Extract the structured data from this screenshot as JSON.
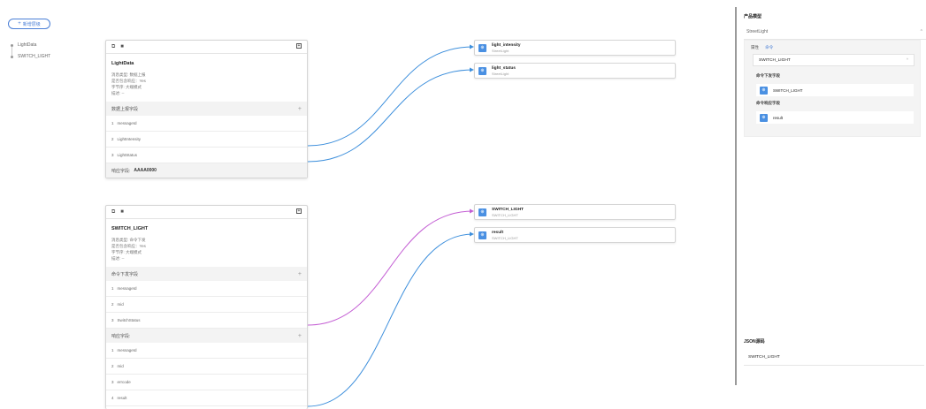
{
  "toolbar": {
    "add_label": "新增层级"
  },
  "tree": {
    "items": [
      "LightData",
      "SWITCH_LIGHT"
    ]
  },
  "cards": [
    {
      "title": "LightData",
      "meta": [
        "消息类型: 数据上报",
        "是否包含响应：Yes",
        "字节序: 大端模式",
        "描述: --"
      ],
      "sections": [
        {
          "label": "数据上报字段",
          "rows": [
            [
              "1",
              "messageId"
            ],
            [
              "2",
              "LightIntensity"
            ],
            [
              "3",
              "LightStatus"
            ]
          ]
        }
      ],
      "footer": {
        "label": "响应字段:",
        "value": "AAAA0000"
      }
    },
    {
      "title": "SWITCH_LIGHT",
      "meta": [
        "消息类型: 命令下发",
        "是否包含响应：Yes",
        "字节序: 大端模式",
        "描述: --"
      ],
      "sections": [
        {
          "label": "命令下发字段",
          "rows": [
            [
              "1",
              "messageId"
            ],
            [
              "2",
              "mid"
            ],
            [
              "3",
              "SwitchStatus"
            ]
          ]
        },
        {
          "label": "响应字段:",
          "rows": [
            [
              "1",
              "messageId"
            ],
            [
              "2",
              "mid"
            ],
            [
              "3",
              "errcode"
            ],
            [
              "4",
              "result"
            ]
          ]
        }
      ]
    }
  ],
  "targets": [
    {
      "name": "light_intensity",
      "sub": "StreetLight"
    },
    {
      "name": "light_status",
      "sub": "StreetLight"
    },
    {
      "name": "SWITCH_LIGHT",
      "sub": "SWITCH_LIGHT"
    },
    {
      "name": "result",
      "sub": "SWITCH_LIGHT"
    }
  ],
  "right_panel": {
    "title": "产品模型",
    "service": "StreetLight",
    "tabs": [
      "属性",
      "命令"
    ],
    "command": "SWITCH_LIGHT",
    "down_label": "命令下发字段",
    "down_field": "SWITCH_LIGHT",
    "resp_label": "命令响应字段",
    "resp_field": "result",
    "json_title": "JSON源码",
    "json_value": "SWITCH_LIGHT"
  },
  "colors": {
    "accent": "#4a90e2",
    "link_blue": "#3d8fdc",
    "link_purple": "#c45fd4"
  }
}
